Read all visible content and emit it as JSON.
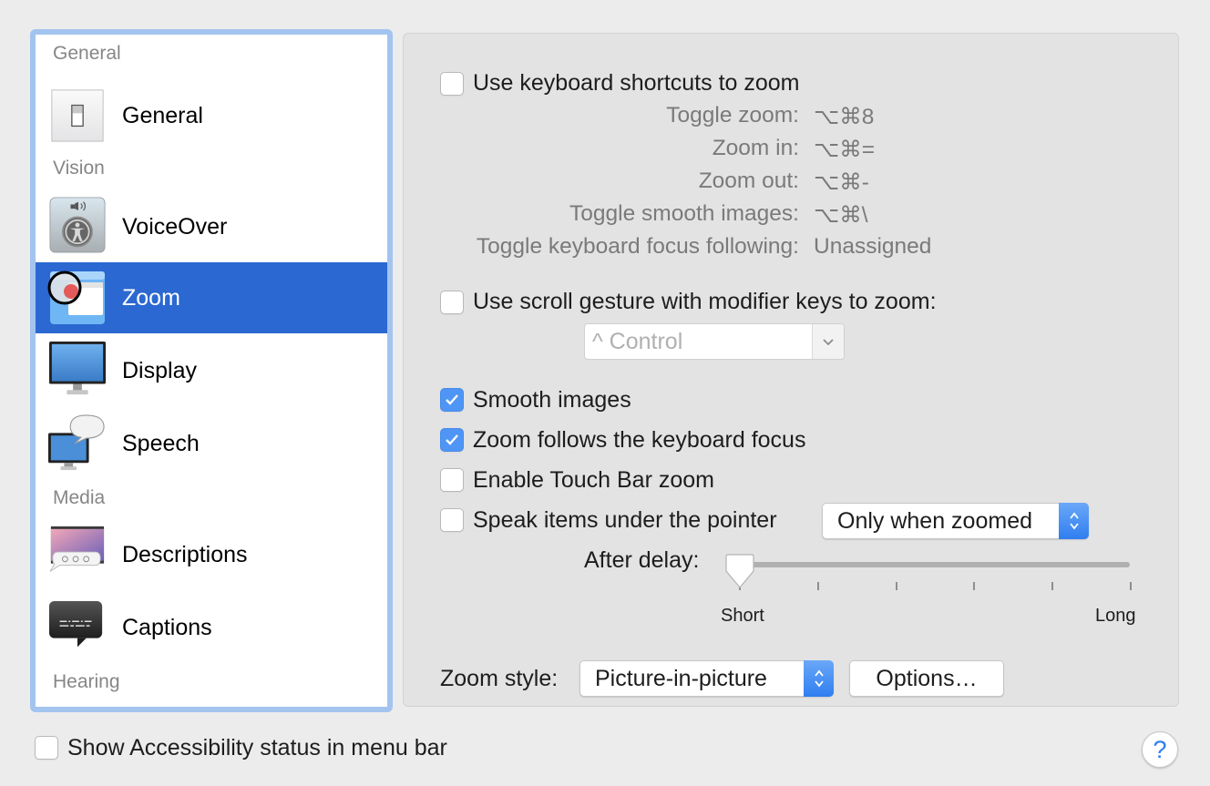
{
  "sidebar": {
    "sections": {
      "general": "General",
      "vision": "Vision",
      "media": "Media",
      "hearing": "Hearing"
    },
    "items": [
      {
        "label": "General",
        "icon": "switch-icon",
        "selected": false
      },
      {
        "label": "VoiceOver",
        "icon": "voiceover-icon",
        "selected": false
      },
      {
        "label": "Zoom",
        "icon": "zoom-icon",
        "selected": true
      },
      {
        "label": "Display",
        "icon": "display-icon",
        "selected": false
      },
      {
        "label": "Speech",
        "icon": "speech-icon",
        "selected": false
      },
      {
        "label": "Descriptions",
        "icon": "descriptions-icon",
        "selected": false
      },
      {
        "label": "Captions",
        "icon": "captions-icon",
        "selected": false
      }
    ]
  },
  "panel": {
    "keyboard_shortcuts": {
      "label": "Use keyboard shortcuts to zoom",
      "checked": false,
      "shortcuts": [
        {
          "label": "Toggle zoom:",
          "value": "⌥⌘8"
        },
        {
          "label": "Zoom in:",
          "value": "⌥⌘="
        },
        {
          "label": "Zoom out:",
          "value": "⌥⌘-"
        },
        {
          "label": "Toggle smooth images:",
          "value": "⌥⌘\\"
        },
        {
          "label": "Toggle keyboard focus following:",
          "value": "Unassigned"
        }
      ]
    },
    "scroll_gesture": {
      "label": "Use scroll gesture with modifier keys to zoom:",
      "checked": false,
      "modifier": "^ Control"
    },
    "smooth_images": {
      "label": "Smooth images",
      "checked": true
    },
    "follow_focus": {
      "label": "Zoom follows the keyboard focus",
      "checked": true
    },
    "touch_bar": {
      "label": "Enable Touch Bar zoom",
      "checked": false
    },
    "speak_items": {
      "label": "Speak items under the pointer",
      "checked": false,
      "mode": "Only when zoomed"
    },
    "delay": {
      "label": "After delay:",
      "min_label": "Short",
      "max_label": "Long",
      "value_fraction": 0,
      "tick_count": 6
    },
    "zoom_style": {
      "label": "Zoom style:",
      "value": "Picture-in-picture",
      "options_button": "Options…"
    }
  },
  "footer": {
    "status_label": "Show Accessibility status in menu bar",
    "status_checked": false,
    "help": "?"
  },
  "colors": {
    "selection": "#2b68d1",
    "checkbox_checked": "#4e95f5",
    "focus_ring": "#a3c4ef"
  }
}
